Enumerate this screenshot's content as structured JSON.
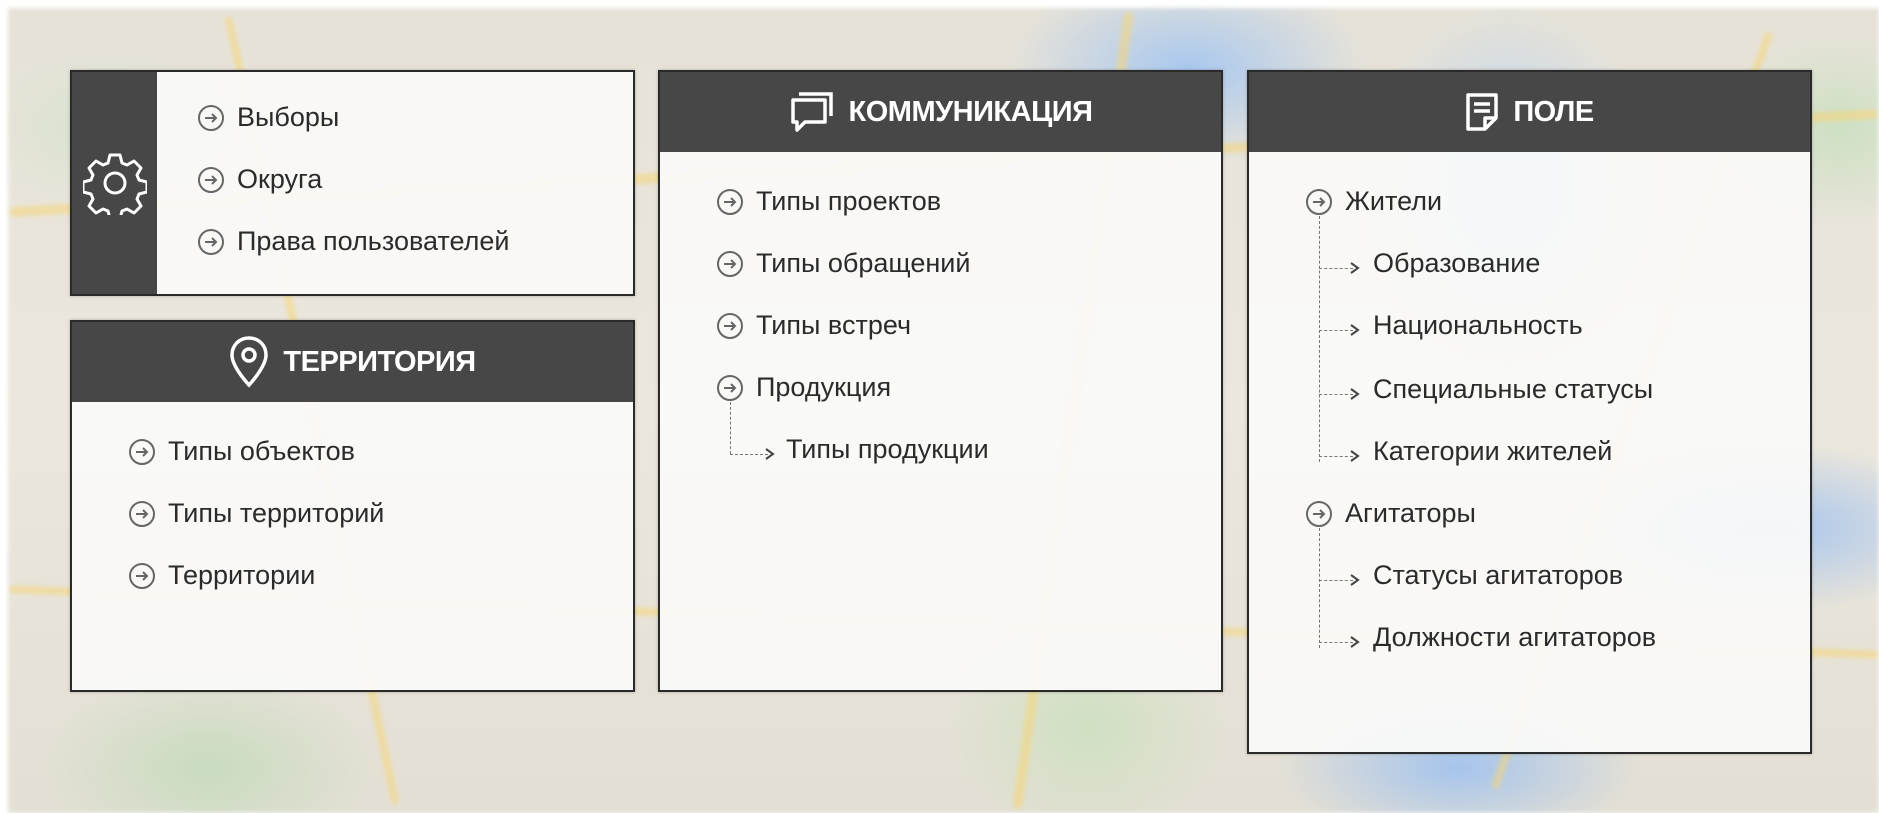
{
  "settings": {
    "items": [
      "Выборы",
      "Округа",
      "Права пользователей"
    ]
  },
  "territory": {
    "title": "ТЕРРИТОРИЯ",
    "items": [
      "Типы объектов",
      "Типы территорий",
      "Территории"
    ]
  },
  "communication": {
    "title": "КОММУНИКАЦИЯ",
    "items": [
      "Типы проектов",
      "Типы обращений",
      "Типы встреч",
      "Продукция"
    ],
    "subitems": [
      "Типы продукции"
    ]
  },
  "field": {
    "title": "ПОЛЕ",
    "groups": [
      {
        "label": "Жители",
        "children": [
          "Образование",
          "Национальность",
          "Специальные статусы",
          "Категории жителей"
        ]
      },
      {
        "label": "Агитаторы",
        "children": [
          "Статусы агитаторов",
          "Должности агитаторов"
        ]
      }
    ]
  },
  "icons": {
    "settings": "gear-icon",
    "territory": "map-pin-icon",
    "communication": "chat-bubble-icon",
    "field": "notes-icon",
    "item": "arrow-circle-icon"
  },
  "colors": {
    "header": "#474747",
    "text": "#2b2b2b"
  }
}
